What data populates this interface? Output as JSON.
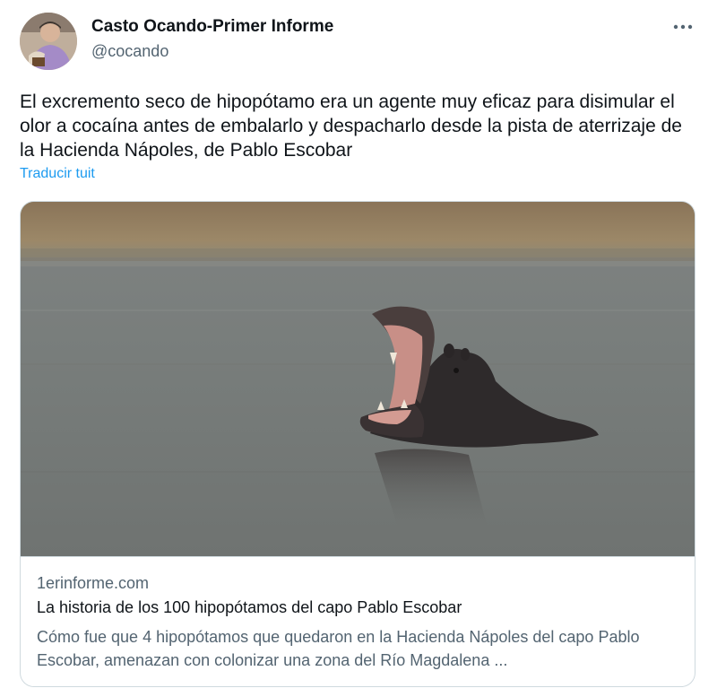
{
  "author": {
    "name": "Casto Ocando-Primer Informe",
    "handle": "@cocando"
  },
  "tweet": {
    "text": "El excremento seco de hipopótamo era un agente muy eficaz para disimular el olor a cocaína antes de embalarlo y despacharlo desde la pista de aterrizaje de la Hacienda Nápoles, de Pablo Escobar",
    "translate_label": "Traducir tuit"
  },
  "card": {
    "domain": "1erinforme.com",
    "title": "La historia de los 100 hipopótamos del capo Pablo Escobar",
    "description": "Cómo fue que 4 hipopótamos que quedaron en la Hacienda Nápoles del capo Pablo Escobar, amenazan con colonizar una zona del Río Magdalena ..."
  },
  "icons": {
    "more": "more-horizontal-icon",
    "avatar": "avatar-photo"
  },
  "colors": {
    "link": "#1d9bf0",
    "secondary_text": "#536471",
    "primary_text": "#0f1419",
    "border": "#cfd9de"
  }
}
